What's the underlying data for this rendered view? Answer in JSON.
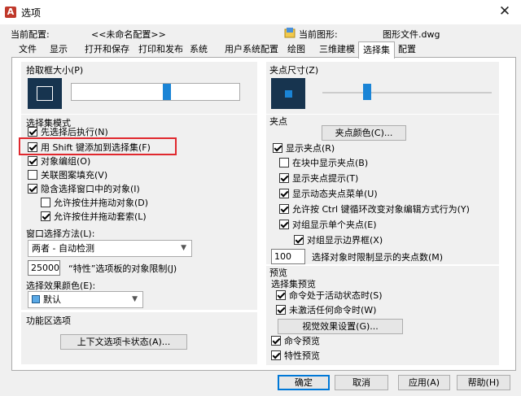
{
  "window": {
    "title": "选项",
    "app_icon": "A",
    "close": "✕"
  },
  "header": {
    "current_profile_label": "当前配置:",
    "current_profile_value": "<<未命名配置>>",
    "current_drawing_label": "当前图形:",
    "current_drawing_value": "图形文件.dwg"
  },
  "tabs": [
    {
      "label": "文件"
    },
    {
      "label": "显示"
    },
    {
      "label": "打开和保存"
    },
    {
      "label": "打印和发布"
    },
    {
      "label": "系统"
    },
    {
      "label": "用户系统配置"
    },
    {
      "label": "绘图"
    },
    {
      "label": "三维建模"
    },
    {
      "label": "选择集",
      "active": true
    },
    {
      "label": "配置"
    }
  ],
  "pickbox": {
    "title": "拾取框大小(P)",
    "slider_fraction": 0.57
  },
  "selection_modes": {
    "title": "选择集模式",
    "items": [
      {
        "label": "先选择后执行(N)",
        "checked": true
      },
      {
        "label": "用 Shift 键添加到选择集(F)",
        "checked": true
      },
      {
        "label": "对象编组(O)",
        "checked": true
      },
      {
        "label": "关联图案填充(V)",
        "checked": false
      },
      {
        "label": "隐含选择窗口中的对象(I)",
        "checked": true
      },
      {
        "label": "允许按住并拖动对象(D)",
        "checked": false
      },
      {
        "label": "允许按住并拖动套索(L)",
        "checked": true
      }
    ],
    "window_method_label": "窗口选择方法(L):",
    "window_method_value": "两者 - 自动检测",
    "object_limit_value": "25000",
    "object_limit_label": "“特性”选项板的对象限制(J)",
    "effect_color_label": "选择效果颜色(E):",
    "effect_color_value": "默认",
    "effect_color_hex": "#5aa9e6"
  },
  "ribbon": {
    "title": "功能区选项",
    "button": "上下文选项卡状态(A)..."
  },
  "grip_size": {
    "title": "夹点尺寸(Z)",
    "slider_fraction": 0.25
  },
  "grips": {
    "title": "夹点",
    "color_button": "夹点颜色(C)...",
    "items": [
      {
        "label": "显示夹点(R)",
        "checked": true
      },
      {
        "label": "在块中显示夹点(B)",
        "checked": false
      },
      {
        "label": "显示夹点提示(T)",
        "checked": true
      },
      {
        "label": "显示动态夹点菜单(U)",
        "checked": true
      },
      {
        "label": "允许按 Ctrl 键循环改变对象编辑方式行为(Y)",
        "checked": true
      },
      {
        "label": "对组显示单个夹点(E)",
        "checked": true
      },
      {
        "label": "对组显示边界框(X)",
        "checked": true
      }
    ],
    "limit_value": "100",
    "limit_label": "选择对象时限制显示的夹点数(M)"
  },
  "preview": {
    "title": "预览",
    "subtitle": "选择集预览",
    "items": [
      {
        "label": "命令处于活动状态时(S)",
        "checked": true
      },
      {
        "label": "未激活任何命令时(W)",
        "checked": true
      }
    ],
    "visual_button": "视觉效果设置(G)...",
    "command_preview": {
      "label": "命令预览",
      "checked": true
    },
    "property_preview": {
      "label": "特性预览",
      "checked": true
    }
  },
  "buttons": {
    "ok": "确定",
    "cancel": "取消",
    "apply": "应用(A)",
    "help": "帮助(H)"
  },
  "colors": {
    "highlight": "#e0282e",
    "accent": "#0078d7",
    "preview_box": "#17344f",
    "slider_thumb": "#1a84d6"
  }
}
